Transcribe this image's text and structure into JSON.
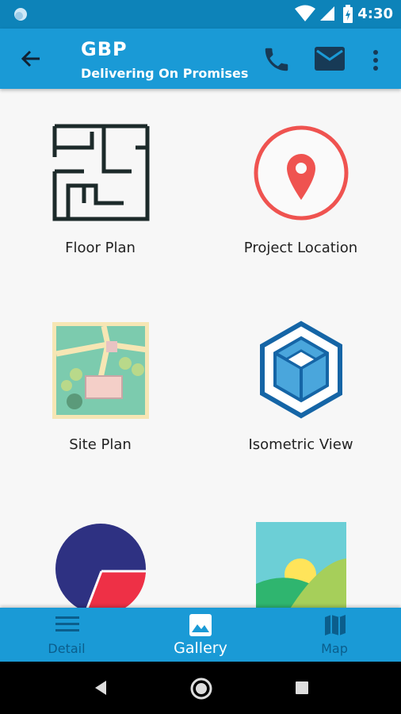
{
  "status_bar": {
    "time": "4:30",
    "icons": [
      "notification-dot-icon",
      "wifi-icon",
      "signal-icon",
      "battery-icon"
    ]
  },
  "app_bar": {
    "title": "GBP",
    "subtitle": "Delivering On Promises",
    "back_icon": "arrow-back-icon",
    "actions": [
      "phone-icon",
      "email-icon",
      "more-vert-icon"
    ]
  },
  "gallery": {
    "items": [
      {
        "label": "Floor Plan",
        "icon": "floor-plan-icon"
      },
      {
        "label": "Project Location",
        "icon": "location-pin-icon"
      },
      {
        "label": "Site Plan",
        "icon": "site-plan-icon"
      },
      {
        "label": "Isometric View",
        "icon": "isometric-cube-icon"
      },
      {
        "label": "",
        "icon": "pie-chart-icon"
      },
      {
        "label": "",
        "icon": "landscape-icon"
      }
    ]
  },
  "bottom_nav": {
    "items": [
      {
        "label": "Detail",
        "icon": "list-icon",
        "active": false
      },
      {
        "label": "Gallery",
        "icon": "image-icon",
        "active": true
      },
      {
        "label": "Map",
        "icon": "map-icon",
        "active": false
      }
    ]
  },
  "colors": {
    "status_bar": "#0d83b9",
    "app_bar": "#1a9ad6",
    "accent_red": "#ef5350",
    "accent_blue": "#1a6fb0"
  }
}
